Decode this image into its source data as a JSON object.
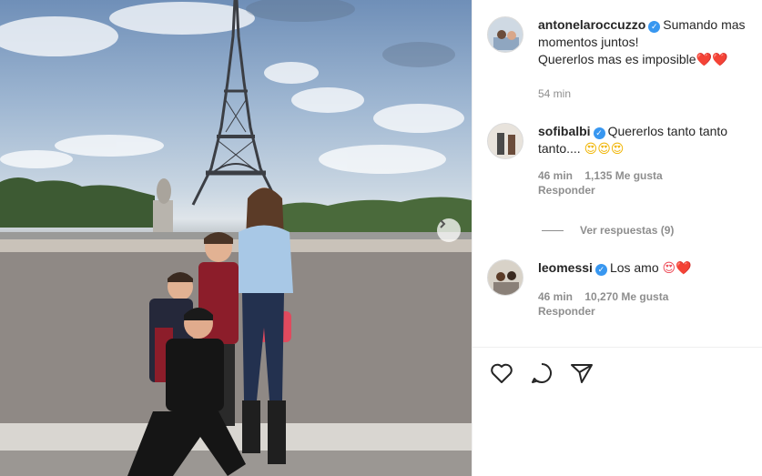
{
  "post": {
    "author": "antonelaroccuzzo",
    "caption_line1": "Sumando mas",
    "caption_line2": "momentos juntos!",
    "caption_line3": "Quererlos mas es imposible",
    "caption_emoji": "❤️❤️",
    "time": "54 min"
  },
  "comments": [
    {
      "user": "sofibalbi",
      "text_line1": "Quererlos tanto tanto",
      "text_line2": "tanto....",
      "emoji": "😍😍😍",
      "time": "46 min",
      "likes": "1,135 Me gusta",
      "reply": "Responder",
      "view_replies": "Ver respuestas (9)"
    },
    {
      "user": "leomessi",
      "text": "Los amo",
      "emoji": "😍❤️",
      "time": "46 min",
      "likes": "10,270 Me gusta",
      "reply": "Responder"
    }
  ],
  "icons": [
    "heart-icon",
    "comment-icon",
    "share-icon",
    "verified-icon",
    "next-arrow-icon"
  ],
  "colors": {
    "verified": "#3897f0",
    "meta_text": "#8e8e8e",
    "heart": "#ed4956"
  }
}
